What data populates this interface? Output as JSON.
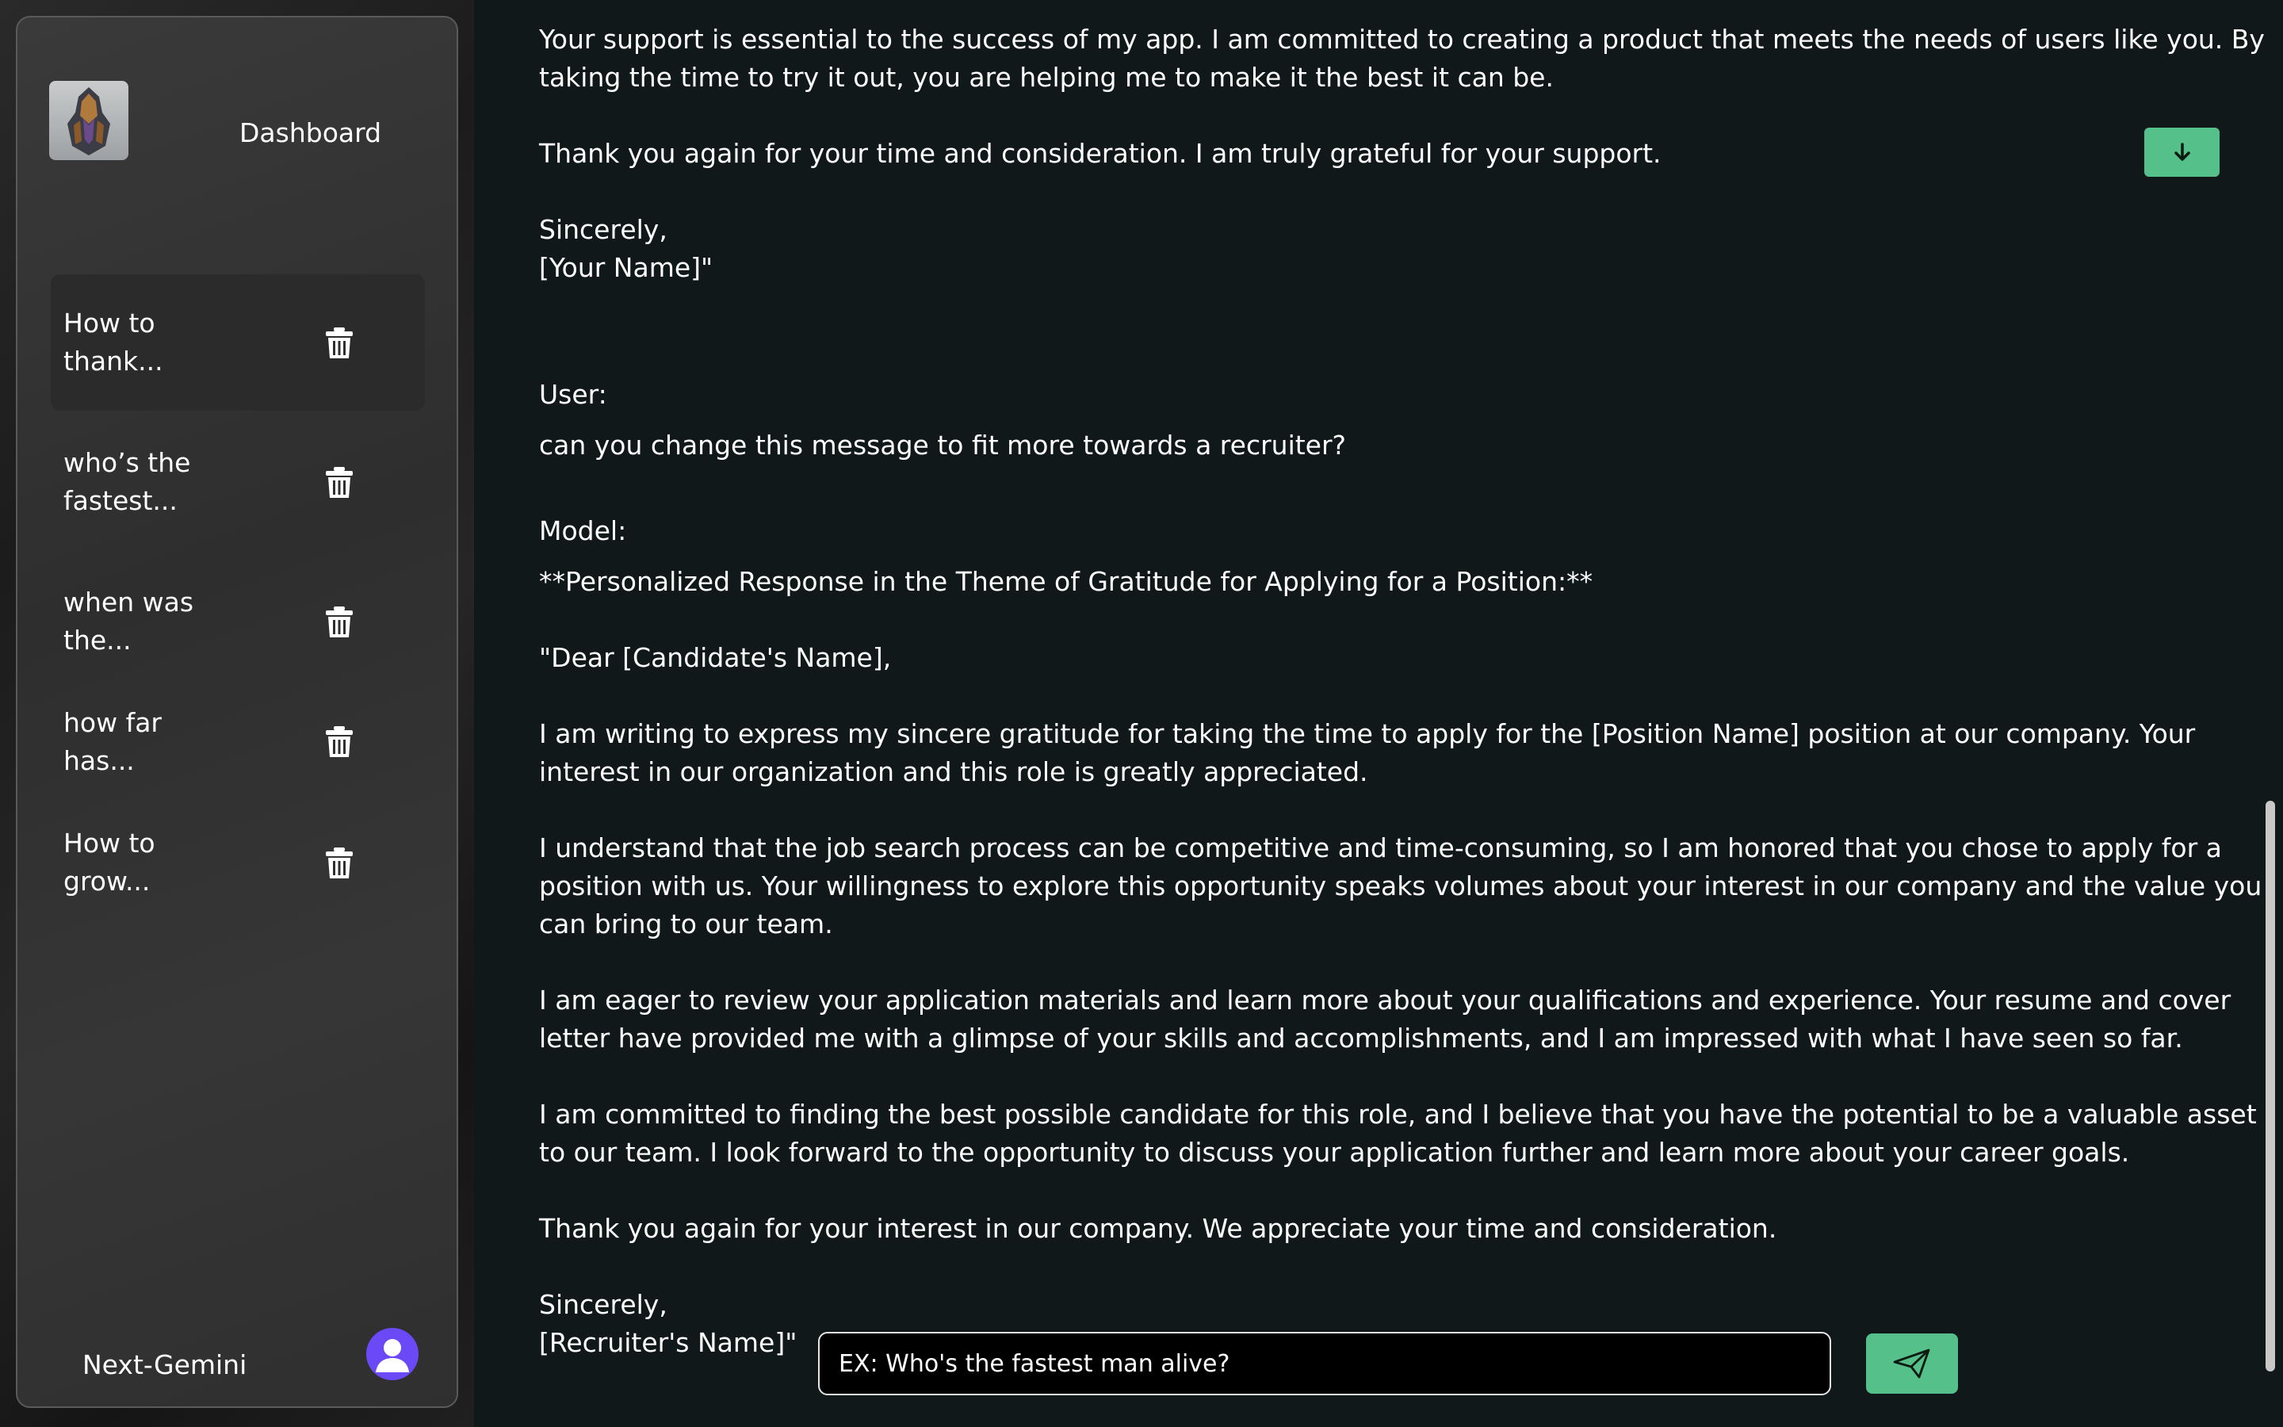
{
  "sidebar": {
    "title": "Dashboard",
    "logo_icon": "warrior-helmet-logo",
    "conversations": [
      {
        "line1": "How to",
        "line2": "thank...",
        "active": true
      },
      {
        "line1": "who’s the",
        "line2": "fastest...",
        "active": false
      },
      {
        "line1": "when was",
        "line2": "the...",
        "active": false
      },
      {
        "line1": "how far has...",
        "line2": "",
        "active": false
      },
      {
        "line1": "How to",
        "line2": "grow...",
        "active": false
      }
    ],
    "delete_icon": "trash-icon",
    "app_name": "Next-Gemini",
    "avatar_icon": "user-avatar-icon"
  },
  "chat": {
    "lines": [
      "Your support is essential to the success of my app. I am committed to creating a product that meets the needs of users like you. By",
      "taking the time to try it out, you are helping me to make it the best it can be.",
      "Thank you again for your time and consideration. I am truly grateful for your support.",
      "Sincerely,",
      "[Your Name]\"",
      "User:",
      "can you change this message to fit more towards a recruiter?",
      "Model:",
      "**Personalized Response in the Theme of Gratitude for Applying for a Position:**",
      "\"Dear [Candidate's Name],",
      "I am writing to express my sincere gratitude for taking the time to apply for the [Position Name] position at our company. Your",
      "interest in our organization and this role is greatly appreciated.",
      "I understand that the job search process can be competitive and time-consuming, so I am honored that you chose to apply for a",
      "position with us. Your willingness to explore this opportunity speaks volumes about your interest in our company and the value you",
      "can bring to our team.",
      "I am eager to review your application materials and learn more about your qualifications and experience. Your resume and cover",
      "letter have provided me with a glimpse of your skills and accomplishments, and I am impressed with what I have seen so far.",
      "I am committed to finding the best possible candidate for this role, and I believe that you have the potential to be a valuable asset",
      "to our team. I look forward to the opportunity to discuss your application further and learn more about your career goals.",
      "Thank you again for your interest in our company. We appreciate your time and consideration.",
      "Sincerely,",
      "[Recruiter's Name]\""
    ],
    "scroll_down_icon": "arrow-down-icon"
  },
  "composer": {
    "placeholder": "EX: Who's the fastest man alive?",
    "value": "",
    "send_icon": "send-paper-plane-icon"
  },
  "colors": {
    "background": "#101819",
    "accent": "#56c08a",
    "avatar": "#6b49f6"
  }
}
